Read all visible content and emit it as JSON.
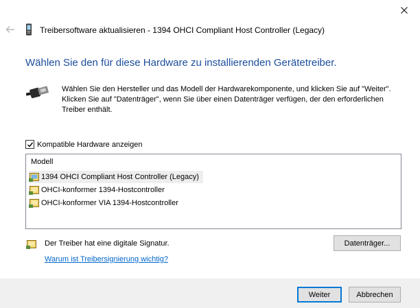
{
  "window": {
    "title": "Treibersoftware aktualisieren - 1394 OHCI Compliant Host Controller (Legacy)"
  },
  "heading": "Wählen Sie den für diese Hardware zu installierenden Gerätetreiber.",
  "description": "Wählen Sie den Hersteller und das Modell der Hardwarekomponente, und klicken Sie auf \"Weiter\". Klicken Sie auf \"Datenträger\", wenn Sie über einen Datenträger verfügen, der den erforderlichen Treiber enthält.",
  "compatible": {
    "label": "Kompatible Hardware anzeigen",
    "checked": true
  },
  "list": {
    "header": "Modell",
    "items": [
      "1394 OHCI Compliant Host Controller (Legacy)",
      "OHCI-konformer 1394-Hostcontroller",
      "OHCI-konformer VIA 1394-Hostcontroller"
    ],
    "selected_index": 0
  },
  "signature": {
    "text": "Der Treiber hat eine digitale Signatur.",
    "link": "Warum ist Treibersignierung wichtig?"
  },
  "buttons": {
    "media": "Datenträger...",
    "next": "Weiter",
    "cancel": "Abbrechen"
  },
  "colors": {
    "heading": "#1b4d9c",
    "link": "#0066cc",
    "default_button_border": "#0078d7",
    "footer_bg": "#f0f0f0"
  },
  "icons": {
    "close": "close-icon",
    "back": "back-arrow-icon",
    "device": "device-icon",
    "hardware": "ieee1394-connector-icon",
    "driver": "driver-signed-icon",
    "checkmark": "checkmark-icon"
  }
}
